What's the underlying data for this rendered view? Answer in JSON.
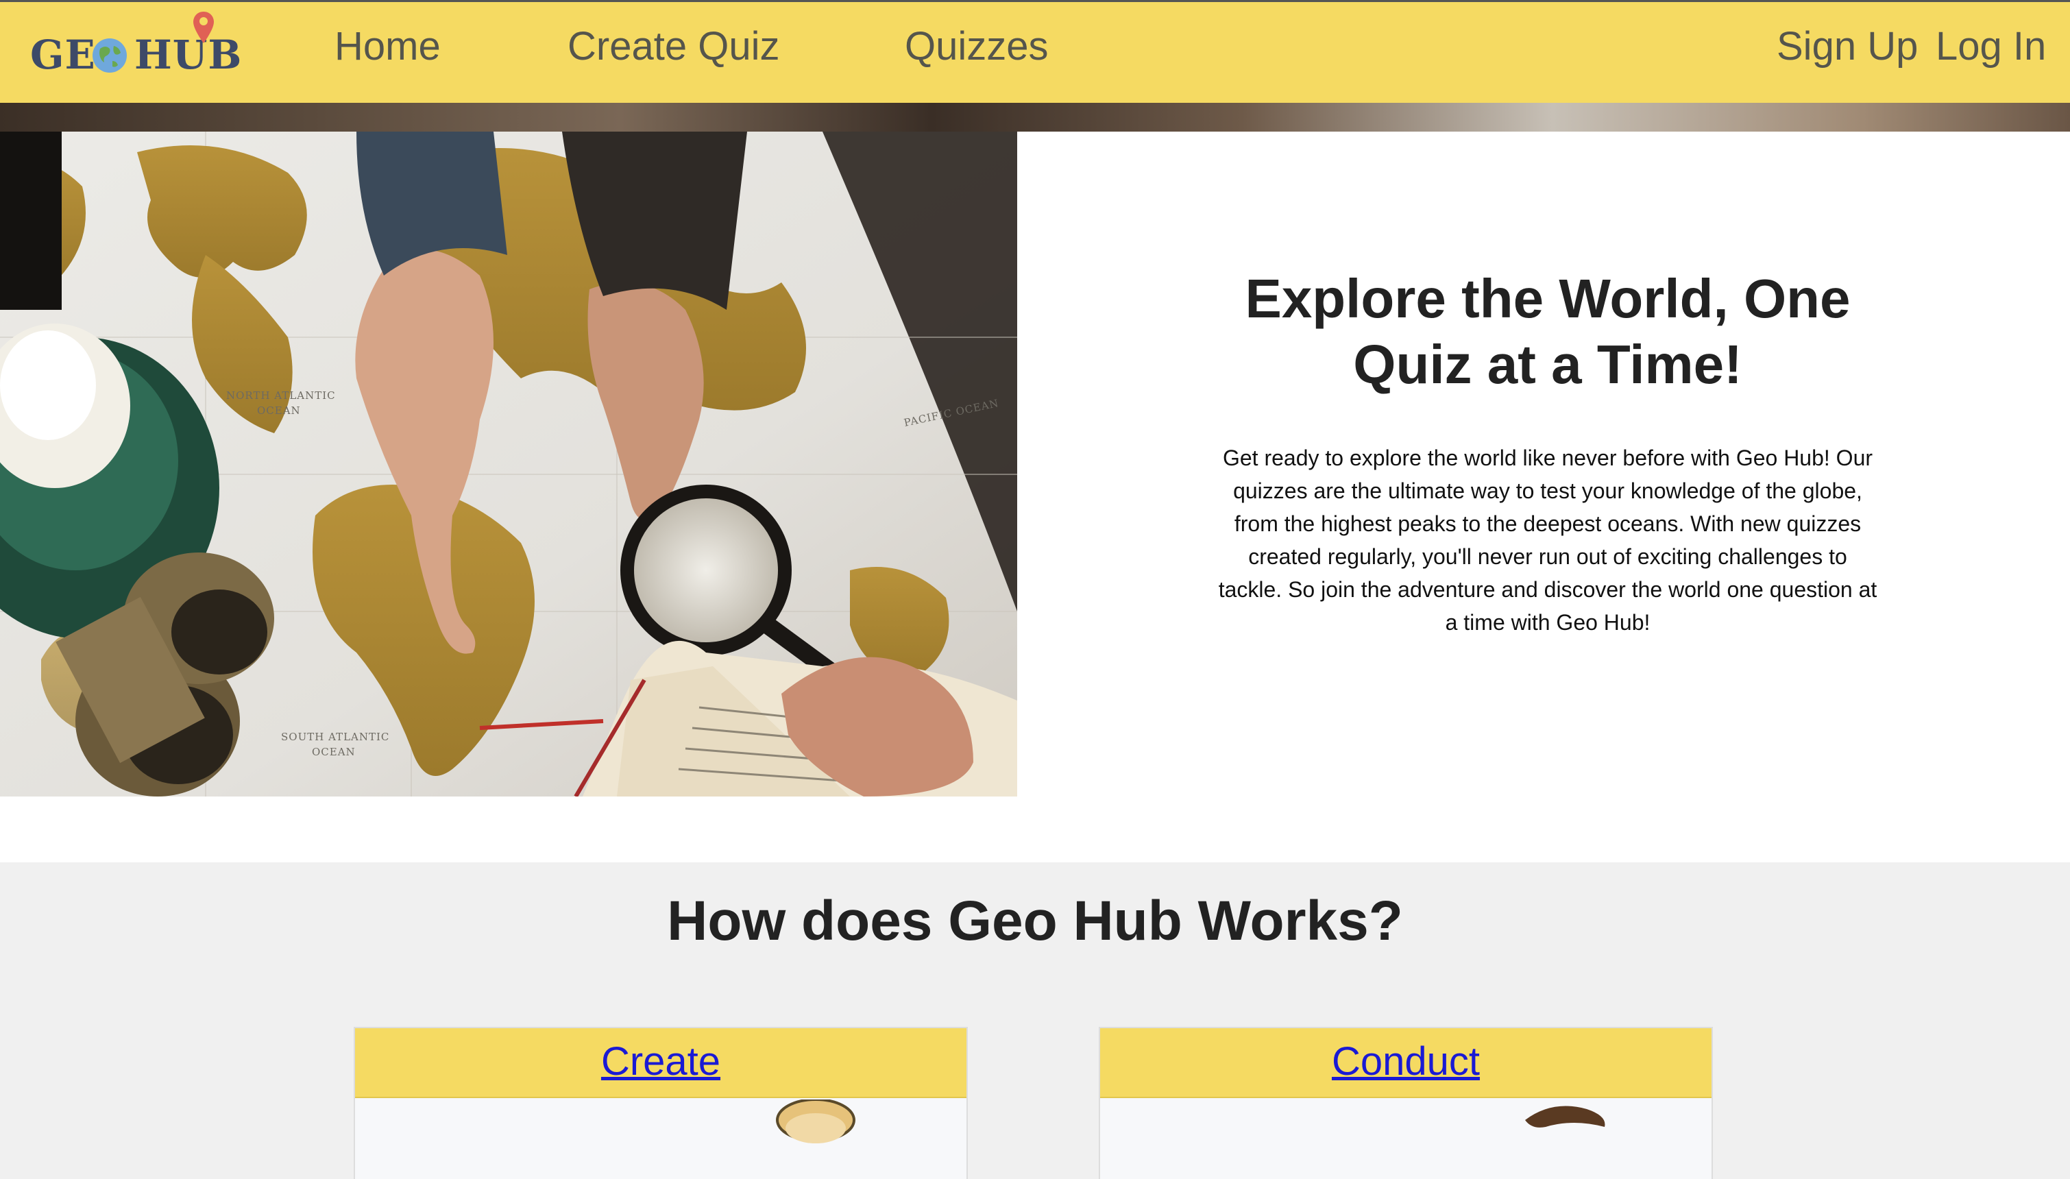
{
  "brand": {
    "logo_text_left": "GE",
    "logo_text_right": "HUB",
    "logo_icon": "globe-icon",
    "logo_pin_icon": "map-pin-icon",
    "primary_color": "#f5da62",
    "logo_color": "#3d4a68"
  },
  "nav": {
    "home": "Home",
    "create_quiz": "Create Quiz",
    "quizzes": "Quizzes",
    "sign_up": "Sign Up",
    "log_in": "Log In"
  },
  "hero": {
    "title": "Explore the World, One Quiz at a Time!",
    "body": "Get ready to explore the world like never before with Geo Hub! Our quizzes are the ultimate way to test your knowledge of the globe, from the highest peaks to the deepest oceans. With new quizzes created regularly, you'll never run out of exciting challenges to tackle. So join the adventure and discover the world one question at a time with Geo Hub!",
    "image_map_labels": {
      "north_atlantic": "NORTH ATLANTIC OCEAN",
      "south_atlantic": "SOUTH ATLANTIC OCEAN",
      "pacific": "PACIFIC OCEAN"
    }
  },
  "how": {
    "title": "How does Geo Hub Works?",
    "cards": [
      {
        "label": "Create"
      },
      {
        "label": "Conduct"
      }
    ]
  }
}
